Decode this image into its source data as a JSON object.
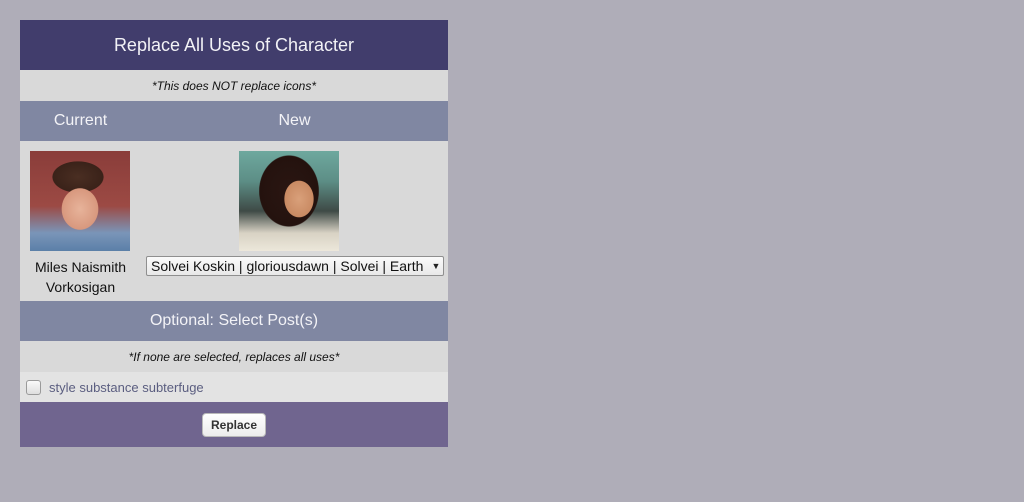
{
  "header": {
    "title": "Replace All Uses of Character",
    "note": "*This does NOT replace icons*"
  },
  "columns": {
    "current": "Current",
    "new": "New"
  },
  "current_character": {
    "name": "Miles Naismith Vorkosigan",
    "avatar_icon": "character-portrait-icon"
  },
  "new_character": {
    "avatar_icon": "character-portrait-icon",
    "selected": "Solvei Koskin | gloriousdawn | Solvei | Earth"
  },
  "posts_section": {
    "title": "Optional: Select Post(s)",
    "note": "*If none are selected, replaces all uses*",
    "posts": [
      {
        "label": "style substance subterfuge",
        "checked": false
      }
    ]
  },
  "footer": {
    "replace_label": "Replace"
  },
  "colors": {
    "title_bg": "#413d6c",
    "section_bg": "#8087a2",
    "footer_bg": "#70658f",
    "page_bg": "#afadb8"
  }
}
